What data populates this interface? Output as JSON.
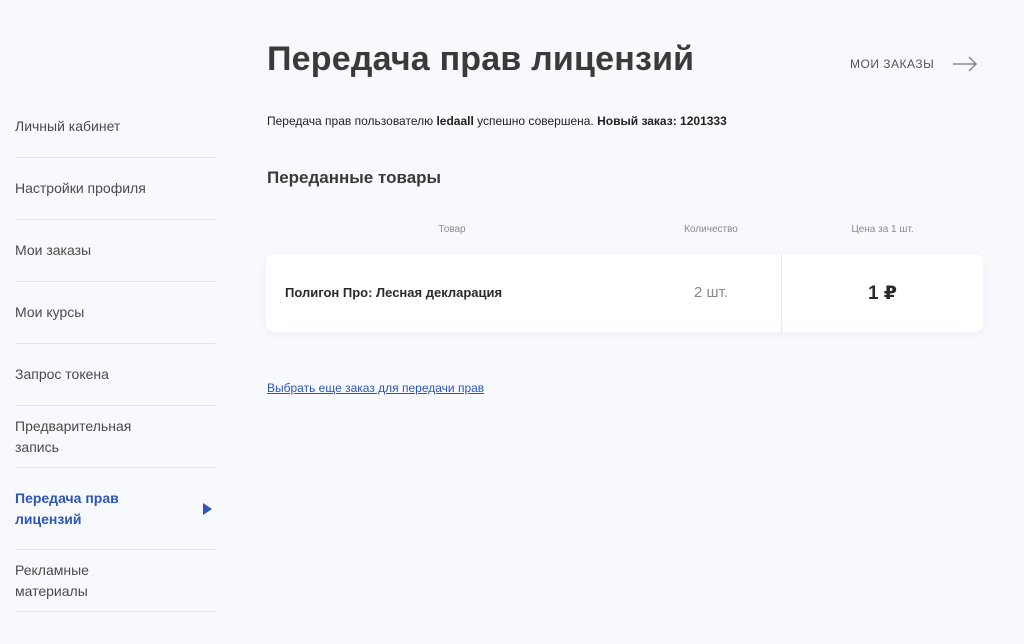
{
  "page": {
    "title": "Передача прав лицензий"
  },
  "header": {
    "orders_link_label": "МОИ ЗАКАЗЫ",
    "orders_link_icon": "arrow-right-icon"
  },
  "sidebar": {
    "items": [
      {
        "label": "Личный кабинет",
        "active": false
      },
      {
        "label": "Настройки профиля",
        "active": false
      },
      {
        "label": "Мои заказы",
        "active": false
      },
      {
        "label": "Мои курсы",
        "active": false
      },
      {
        "label": "Запрос токена",
        "active": false
      },
      {
        "label": "Предварительная запись",
        "active": false
      },
      {
        "label": "Передача прав лицензий",
        "active": true
      },
      {
        "label": "Рекламные материалы",
        "active": false
      }
    ],
    "active_color": "#2c56b8"
  },
  "message": {
    "prefix": "Передача прав пользователю ",
    "username": "ledaall",
    "middle": " успешно совершена. ",
    "order_label": "Новый заказ: 1201333"
  },
  "section": {
    "title": "Переданные товары"
  },
  "table": {
    "columns": [
      "Товар",
      "Количество",
      "Цена за 1 шт."
    ],
    "rows": [
      {
        "product": "Полигон Про: Лесная декларация",
        "quantity": "2 шт.",
        "price": "1 ₽"
      }
    ]
  },
  "footer": {
    "more_link_label": "Выбрать еще заказ для передачи прав"
  }
}
